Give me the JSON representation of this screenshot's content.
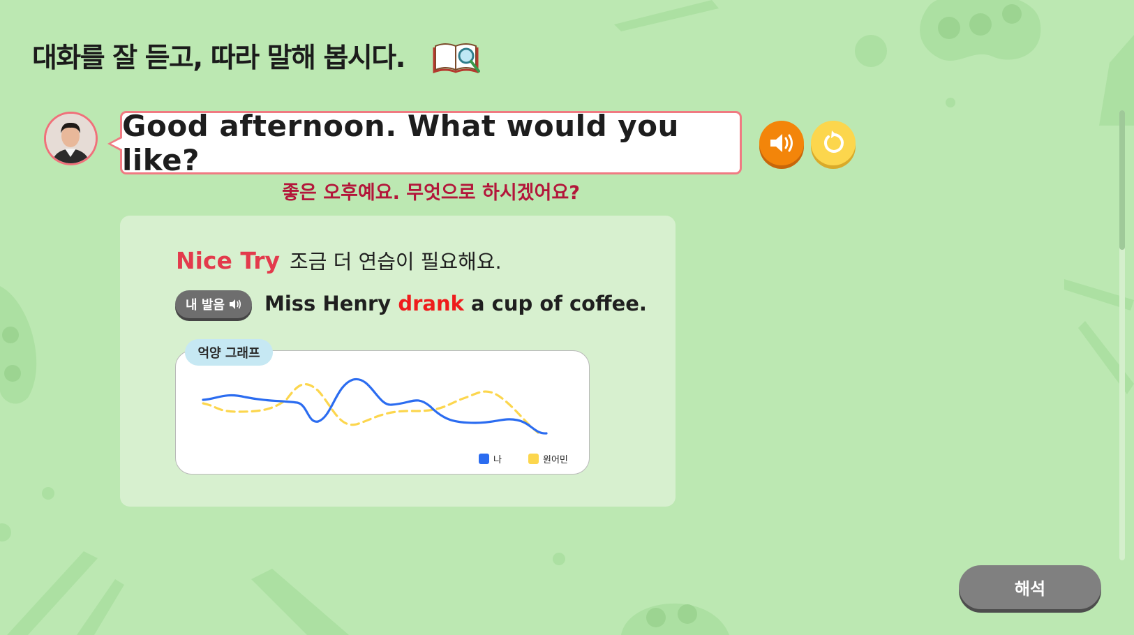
{
  "instruction": "대화를 잘 듣고, 따라 말해 봅시다.",
  "dialogue": {
    "english": "Good afternoon. What would you like?",
    "korean": "좋은 오후예요. 무엇으로 하시겠어요?"
  },
  "feedback": {
    "grade": "Nice Try",
    "message": "조금 더 연습이 필요해요.",
    "my_pronunciation_label": "내 발음",
    "sentence_before": "Miss Henry ",
    "sentence_error_word": "drank",
    "sentence_after": " a cup of coffee."
  },
  "graph": {
    "tag": "억양 그래프",
    "legend": [
      {
        "label": "나",
        "color": "#2b6cf0"
      },
      {
        "label": "원어민",
        "color": "#fcd64d"
      }
    ]
  },
  "buttons": {
    "interpret": "해석"
  },
  "icons": {
    "book": "book-magnifier-icon",
    "sound": "speaker-icon",
    "replay": "replay-icon"
  },
  "colors": {
    "background": "#bce8b2",
    "accent_orange": "#f3850a",
    "accent_yellow": "#fcd64d",
    "error_red": "#ee1c1c",
    "nice_try": "#e33a4c",
    "translation": "#b3163a"
  }
}
